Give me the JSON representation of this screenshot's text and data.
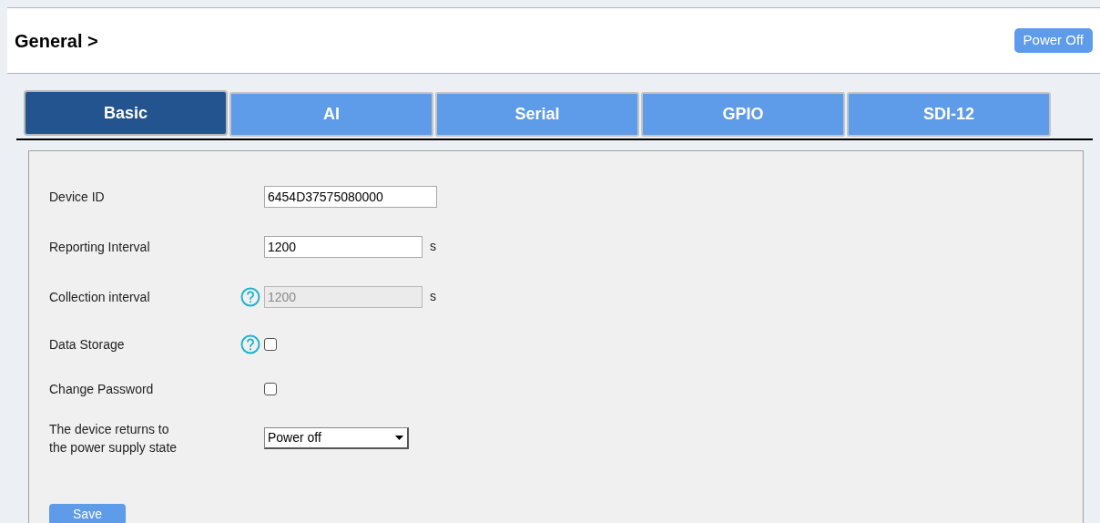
{
  "header": {
    "title": "General >",
    "power_button": "Power Off"
  },
  "tabs": [
    {
      "label": "Basic",
      "selected": true
    },
    {
      "label": "AI",
      "selected": false
    },
    {
      "label": "Serial",
      "selected": false
    },
    {
      "label": "GPIO",
      "selected": false
    },
    {
      "label": "SDI-12",
      "selected": false
    }
  ],
  "fields": [
    {
      "kind": "text",
      "label": "Device ID",
      "value": "6454D37575080000",
      "help": false,
      "disabled": false
    },
    {
      "kind": "text",
      "label": "Reporting Interval",
      "value": "1200",
      "unit": "s",
      "help": false,
      "disabled": false
    },
    {
      "kind": "text",
      "label": "Collection interval",
      "value": "1200",
      "unit": "s",
      "help": true,
      "disabled": true
    },
    {
      "kind": "checkbox",
      "label": "Data Storage",
      "checked": false,
      "help": true
    },
    {
      "kind": "checkbox",
      "label": "Change Password",
      "checked": false,
      "help": false
    },
    {
      "kind": "select",
      "label": "The device returns to the power supply state",
      "value": "Power off",
      "help": false
    }
  ],
  "save_button": "Save"
}
